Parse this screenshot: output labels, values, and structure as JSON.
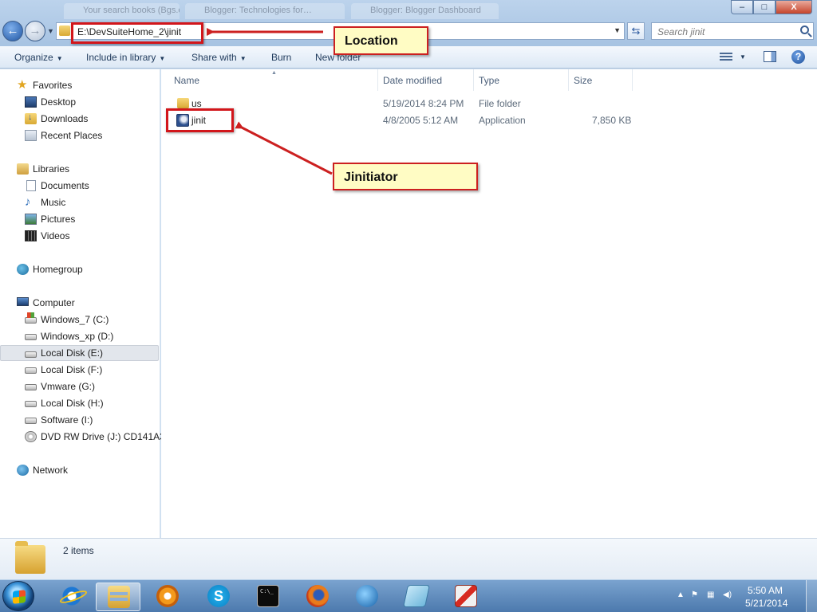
{
  "window": {
    "background_tabs": [
      "Your search books (Bgs.edu.au/…)",
      "Blogger: Technologies for…",
      "Blogger: Blogger Dashboard"
    ],
    "controls": {
      "minimize": "–",
      "maximize": "□",
      "close": "X"
    }
  },
  "address": {
    "path": "E:\\DevSuiteHome_2\\jinit"
  },
  "search": {
    "placeholder": "Search jinit"
  },
  "toolbar": {
    "organize": "Organize",
    "include_in_library": "Include in library",
    "share_with": "Share with",
    "burn": "Burn",
    "new_folder": "New folder",
    "dropdown_glyph": "▼"
  },
  "navigation": {
    "favorites": {
      "label": "Favorites",
      "items": [
        "Desktop",
        "Downloads",
        "Recent Places"
      ]
    },
    "libraries": {
      "label": "Libraries",
      "items": [
        "Documents",
        "Music",
        "Pictures",
        "Videos"
      ]
    },
    "homegroup": {
      "label": "Homegroup"
    },
    "computer": {
      "label": "Computer",
      "drives": [
        "Windows_7 (C:)",
        "Windows_xp (D:)",
        "Local Disk (E:)",
        "Local Disk (F:)",
        "Vmware (G:)",
        "Local Disk (H:)",
        "Software (I:)",
        "DVD RW Drive (J:) CD141A3"
      ],
      "selected": "Local Disk (E:)"
    },
    "network": {
      "label": "Network"
    }
  },
  "columns": {
    "name": "Name",
    "date_modified": "Date modified",
    "type": "Type",
    "size": "Size"
  },
  "files": [
    {
      "name": "us",
      "date": "5/19/2014 8:24 PM",
      "type": "File folder",
      "size": "",
      "icon": "folder-icon"
    },
    {
      "name": "jinit",
      "date": "4/8/2005 5:12 AM",
      "type": "Application",
      "size": "7,850 KB",
      "icon": "application-icon"
    }
  ],
  "annotations": {
    "location": "Location",
    "jinitiator": "Jinitiator",
    "color": "#cc2020",
    "fill": "#fffcc4"
  },
  "details": {
    "count": "2 items"
  },
  "taskbar": {
    "apps": [
      "internet-explorer",
      "windows-explorer",
      "media-player",
      "skype",
      "command-prompt",
      "firefox",
      "network-app",
      "notepad",
      "tool"
    ],
    "time": "5:50 AM",
    "date": "5/21/2014"
  }
}
